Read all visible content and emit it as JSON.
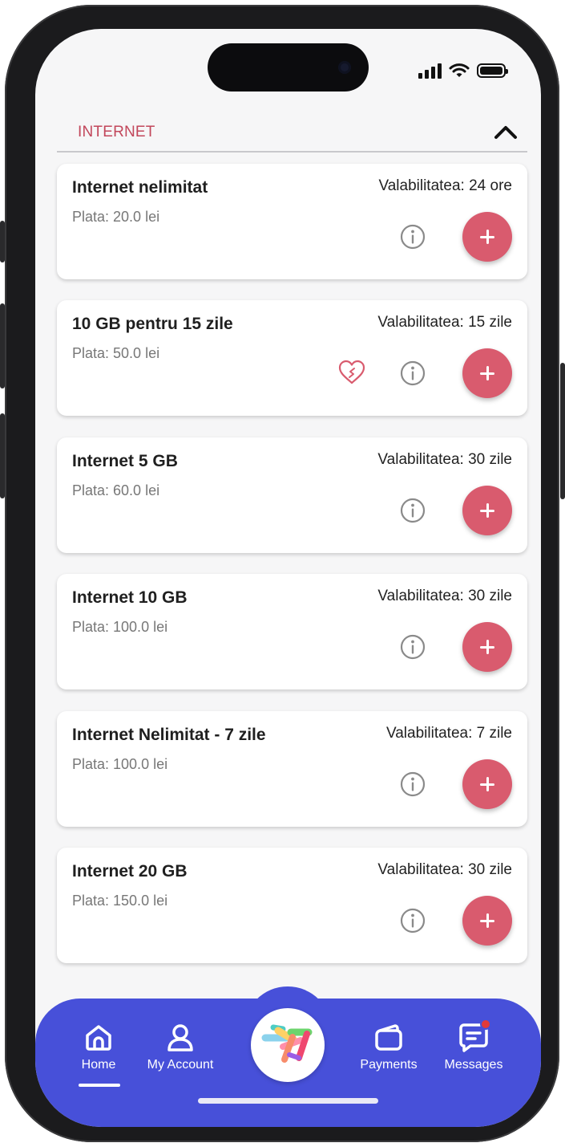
{
  "section": {
    "title": "INTERNET",
    "toggle_icon": "chevron-up-icon"
  },
  "cards": [
    {
      "title": "Internet nelimitat",
      "price": "Plata: 20.0 lei",
      "validity": "Valabilitatea: 24 ore",
      "favorite": false
    },
    {
      "title": "10 GB pentru 15 zile",
      "price": "Plata: 50.0 lei",
      "validity": "Valabilitatea: 15 zile",
      "favorite": true
    },
    {
      "title": "Internet 5 GB",
      "price": "Plata: 60.0 lei",
      "validity": "Valabilitatea: 30 zile",
      "favorite": false
    },
    {
      "title": "Internet 10 GB",
      "price": "Plata: 100.0 lei",
      "validity": "Valabilitatea: 30 zile",
      "favorite": false
    },
    {
      "title": "Internet Nelimitat - 7 zile",
      "price": "Plata: 100.0 lei",
      "validity": "Valabilitatea: 7 zile",
      "favorite": false
    },
    {
      "title": "Internet 20 GB",
      "price": "Plata: 150.0 lei",
      "validity": "Valabilitatea: 30 zile",
      "favorite": false
    }
  ],
  "nav": {
    "home": "Home",
    "account": "My Account",
    "payments": "Payments",
    "messages": "Messages",
    "active": "home"
  },
  "colors": {
    "accent": "#d95b6e",
    "section_title": "#c2475b",
    "nav_bg": "#4750d9"
  }
}
